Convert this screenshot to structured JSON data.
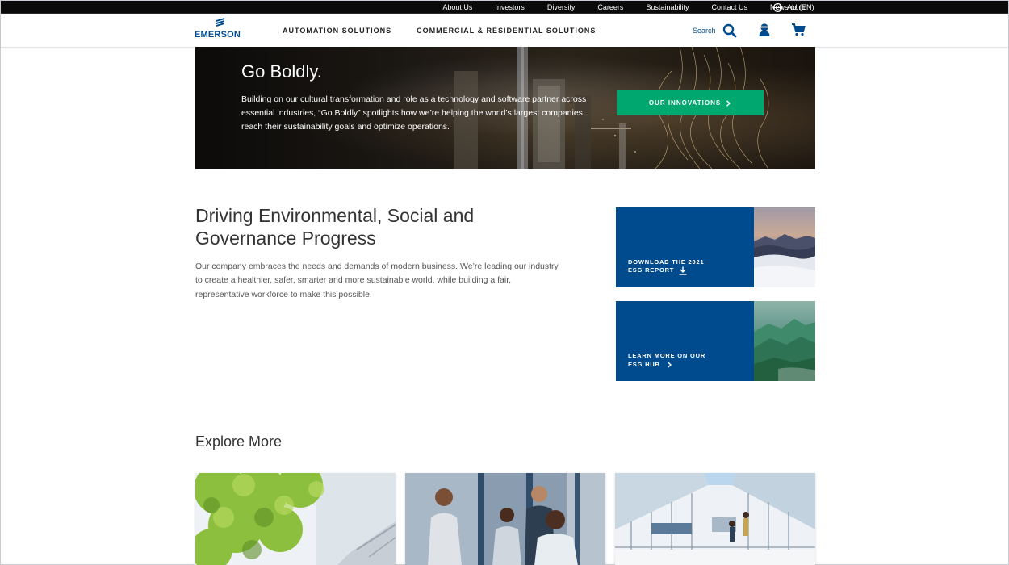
{
  "utility_nav": {
    "links": [
      "About Us",
      "Investors",
      "Diversity",
      "Careers",
      "Sustainability",
      "Contact Us",
      "Newsroom"
    ],
    "locale": "AU (EN)",
    "locale_icon": "globe-icon"
  },
  "header": {
    "logo_text": "EMERSON",
    "nav": [
      "AUTOMATION SOLUTIONS",
      "COMMERCIAL & RESIDENTIAL SOLUTIONS"
    ],
    "search_label": "Search",
    "icons": [
      "search-icon",
      "user-icon",
      "cart-icon"
    ]
  },
  "hero": {
    "title": "Go Boldly.",
    "text": "Building on our cultural transformation and role as a technology and software partner across essential industries, “Go Boldly” spotlights how we’re helping the world’s largest companies reach their sustainability goals and optimize operations.",
    "button": "OUR INNOVATIONS"
  },
  "esg": {
    "title": "Driving Environmental, Social and Governance Progress",
    "text": "Our company embraces the needs and demands of modern business. We’re leading our industry to create a healthier, safer, smarter and more sustainable world, while building a fair, representative workforce to make this possible.",
    "cards": [
      {
        "line1": "DOWNLOAD THE 2021",
        "line2": "ESG REPORT",
        "icon": "download-icon"
      },
      {
        "line1": "LEARN MORE ON OUR",
        "line2": "ESG HUB",
        "icon": "chevron-right-icon"
      }
    ]
  },
  "explore": {
    "title": "Explore More"
  },
  "colors": {
    "brand_blue": "#004b8d",
    "cta_green": "#00a76f",
    "utility_bar": "#0a0a0a"
  }
}
